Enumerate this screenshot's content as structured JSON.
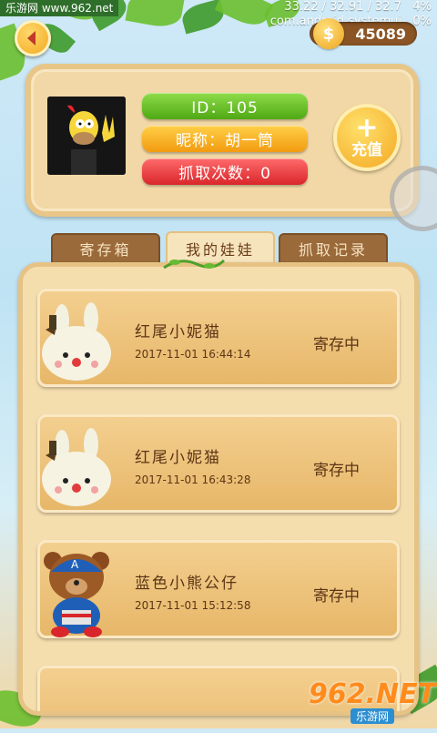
{
  "watermark_top": "乐游网 www.962.net",
  "status": {
    "line1": "33.22 / 32.91 / 32.7",
    "battery": "4%",
    "line2": "com.android.systemui",
    "cpu": "0%"
  },
  "coins": "45089",
  "coin_symbol": "$",
  "profile": {
    "id_text": "ID：105",
    "nickname_text": "昵称：胡一筒",
    "grab_count_text": "抓取次数：0",
    "recharge_plus": "+",
    "recharge_label": "充值"
  },
  "tabs": [
    {
      "label": "寄存箱",
      "active": false
    },
    {
      "label": "我的娃娃",
      "active": true
    },
    {
      "label": "抓取记录",
      "active": false
    }
  ],
  "items": [
    {
      "name": "红尾小妮猫",
      "time": "2017-11-01 16:44:14",
      "status": "寄存中",
      "icon": "bunny-plush"
    },
    {
      "name": "红尾小妮猫",
      "time": "2017-11-01 16:43:28",
      "status": "寄存中",
      "icon": "bunny-plush"
    },
    {
      "name": "蓝色小熊公仔",
      "time": "2017-11-01 15:12:58",
      "status": "寄存中",
      "icon": "captain-bear-plush"
    }
  ],
  "watermark_br": {
    "num": "962.NET",
    "site": "乐游网"
  }
}
